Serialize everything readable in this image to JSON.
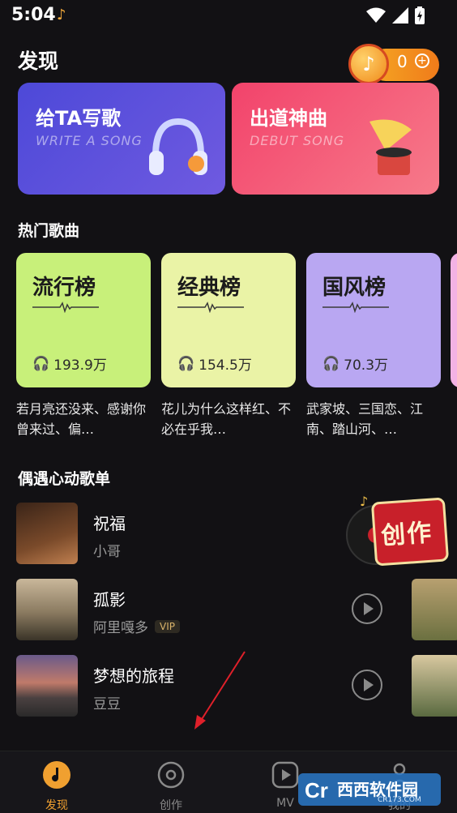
{
  "status": {
    "time": "5:04"
  },
  "header": {
    "title": "发现",
    "coin_count": "0",
    "coin_plus": "+"
  },
  "banners": [
    {
      "title": "给TA写歌",
      "subtitle": "WRITE A SONG",
      "color": "#4d49d8"
    },
    {
      "title": "出道神曲",
      "subtitle": "DEBUT SONG",
      "color": "#f2436b"
    }
  ],
  "hot": {
    "section_title": "热门歌曲",
    "cards": [
      {
        "title": "流行榜",
        "plays": "193.9万",
        "desc": "若月亮还没来、感谢你曾来过、偏…",
        "color": "#c8f07a"
      },
      {
        "title": "经典榜",
        "plays": "154.5万",
        "desc": "花儿为什么这样红、不必在乎我…",
        "color": "#eaf3a6"
      },
      {
        "title": "国风榜",
        "plays": "70.3万",
        "desc": "武家坡、三国恋、江南、踏山河、…",
        "color": "#b9a7f2"
      }
    ]
  },
  "playlist": {
    "section_title": "偶遇心动歌单",
    "items": [
      {
        "song": "祝福",
        "artist": "小哥",
        "vip": ""
      },
      {
        "song": "孤影",
        "artist": "阿里嘎多",
        "vip": "VIP"
      },
      {
        "song": "梦想的旅程",
        "artist": "豆豆",
        "vip": ""
      }
    ]
  },
  "create_float": {
    "label": "创作"
  },
  "tabs": [
    {
      "label": "发现",
      "icon": "music-note-icon",
      "active": true
    },
    {
      "label": "创作",
      "icon": "record-icon",
      "active": false
    },
    {
      "label": "MV",
      "icon": "video-icon",
      "active": false
    },
    {
      "label": "我的",
      "icon": "person-icon",
      "active": false
    }
  ],
  "watermark": {
    "text": "西西软件园",
    "sub": "CR173.COM"
  },
  "colors": {
    "accent": "#f0a030",
    "background": "#121114"
  }
}
